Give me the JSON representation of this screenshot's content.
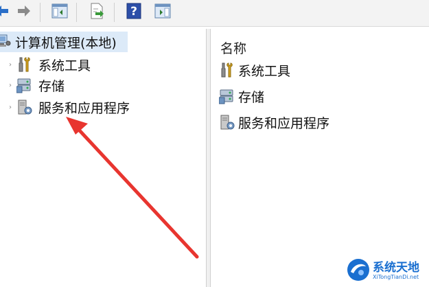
{
  "toolbar": {
    "buttons": [
      {
        "icon": "back-arrow-icon"
      },
      {
        "icon": "forward-arrow-icon"
      },
      {
        "icon": "show-hide-console-tree-icon"
      },
      {
        "icon": "export-list-icon"
      },
      {
        "icon": "help-icon"
      },
      {
        "icon": "show-hide-action-pane-icon"
      }
    ]
  },
  "tree": {
    "root": {
      "label": "计算机管理(本地)",
      "icon": "computer-management-icon"
    },
    "items": [
      {
        "label": "系统工具",
        "icon": "system-tools-icon"
      },
      {
        "label": "存储",
        "icon": "storage-icon"
      },
      {
        "label": "服务和应用程序",
        "icon": "services-applications-icon"
      }
    ]
  },
  "list": {
    "column_header": "名称",
    "items": [
      {
        "label": "系统工具",
        "icon": "system-tools-icon"
      },
      {
        "label": "存储",
        "icon": "storage-icon"
      },
      {
        "label": "服务和应用程序",
        "icon": "services-applications-icon"
      }
    ]
  },
  "watermark": {
    "title": "系统天地",
    "subtitle": "XiTongTianDi.net"
  },
  "colors": {
    "selection": "#dceaf8",
    "arrow": "#e8352f",
    "brand": "#1a6fd0"
  }
}
